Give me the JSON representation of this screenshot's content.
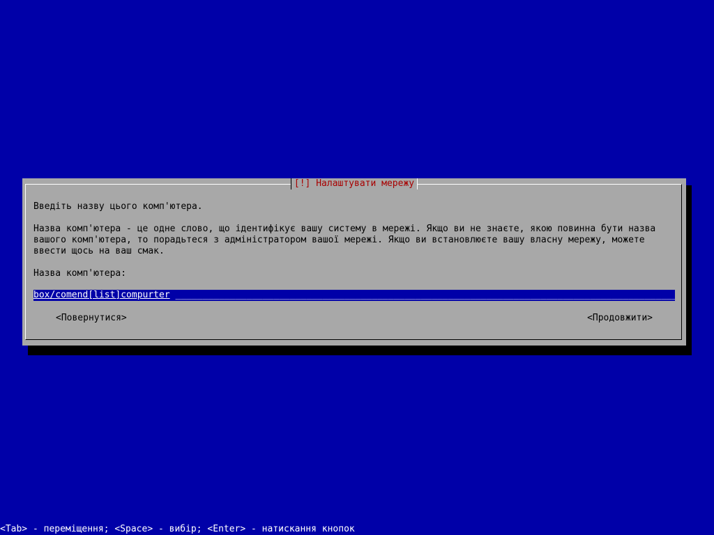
{
  "dialog": {
    "title": "[!] Налаштувати мережу",
    "prompt": "Введіть назву цього комп'ютера.",
    "description": "Назва комп'ютера - це одне слово, що ідентифікує вашу систему в мережі. Якщо ви не знаєте, якою повинна бути назва\nвашого комп'ютера, то порадьтеся з адміністратором вашої мережі. Якщо ви встановлюєте вашу власну мережу, можете\nввести щось на ваш смак.",
    "field_label": "Назва комп'ютера:",
    "hostname_value": "box/comend[list]compurter",
    "back_button": "<Повернутися>",
    "continue_button": "<Продовжити>"
  },
  "statusbar": {
    "text": "<Tab> - переміщення; <Space> - вибір; <Enter> - натискання кнопок"
  },
  "colors": {
    "background": "#0000a8",
    "dialog": "#a8a8a8",
    "title_text": "#a80000",
    "input_bg": "#0000a8"
  }
}
